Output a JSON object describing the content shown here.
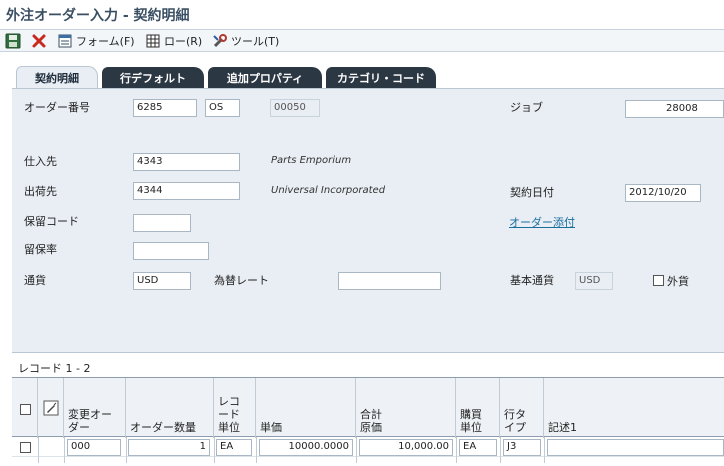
{
  "window": {
    "title": "外注オーダー入力 - 契約明細"
  },
  "toolbar": {
    "save_icon": "save-icon",
    "cancel_icon": "close-icon",
    "form_label": "フォーム(F)",
    "row_label": "ロー(R)",
    "tools_label": "ツール(T)"
  },
  "tabs": [
    {
      "label": "契約明細",
      "active": true
    },
    {
      "label": "行デフォルト",
      "active": false
    },
    {
      "label": "追加プロパティ",
      "active": false
    },
    {
      "label": "カテゴリ・コード",
      "active": false
    }
  ],
  "form": {
    "order_no_label": "オーダー番号",
    "order_no": "6285",
    "order_type": "OS",
    "order_company": "00050",
    "job_label": "ジョブ",
    "job": "28008",
    "supplier_label": "仕入先",
    "supplier": "4343",
    "supplier_name": "Parts Emporium",
    "ship_to_label": "出荷先",
    "ship_to": "4344",
    "ship_to_name": "Universal Incorporated",
    "contract_date_label": "契約日付",
    "contract_date": "2012/10/20",
    "retainage_code_label": "保留コード",
    "retainage_code": "",
    "attachment_link": "オーダー添付",
    "retainage_rate_label": "留保率",
    "retainage_rate": "",
    "currency_label": "通貨",
    "currency": "USD",
    "exchange_rate_label": "為替レート",
    "exchange_rate": "",
    "base_currency_label": "基本通貨",
    "base_currency": "USD",
    "foreign_label": "外貨",
    "foreign_checked": false
  },
  "grid": {
    "caption": "レコード 1 - 2",
    "columns": [
      "変更オーダー",
      "オーダー数量",
      "レコード単位",
      "単価",
      "合計原価",
      "購買単位",
      "行タイプ",
      "記述1"
    ],
    "rows": [
      {
        "change_order": "000",
        "qty": "1",
        "uom": "EA",
        "unit_cost": "10000.0000",
        "extended_cost": "10,000.00",
        "purchasing_uom": "EA",
        "line_type": "J3",
        "description": ""
      }
    ]
  }
}
